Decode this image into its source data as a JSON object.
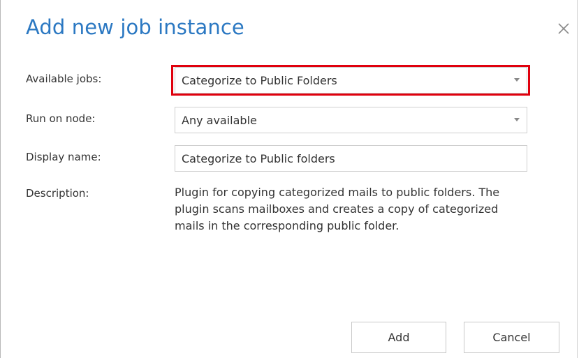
{
  "dialog": {
    "title": "Add new job instance",
    "close_icon": "close-icon"
  },
  "fields": {
    "available_jobs": {
      "label": "Available jobs:",
      "value": "Categorize to Public Folders"
    },
    "run_on_node": {
      "label": "Run on node:",
      "value": "Any available"
    },
    "display_name": {
      "label": "Display name:",
      "value": "Categorize to Public folders"
    },
    "description": {
      "label": "Description:",
      "value": "Plugin for copying categorized mails to public folders. The plugin scans mailboxes and creates a copy of categorized mails in the corresponding public folder."
    }
  },
  "buttons": {
    "add": "Add",
    "cancel": "Cancel"
  },
  "colors": {
    "title": "#2b78c2",
    "highlight": "#e0000d"
  }
}
